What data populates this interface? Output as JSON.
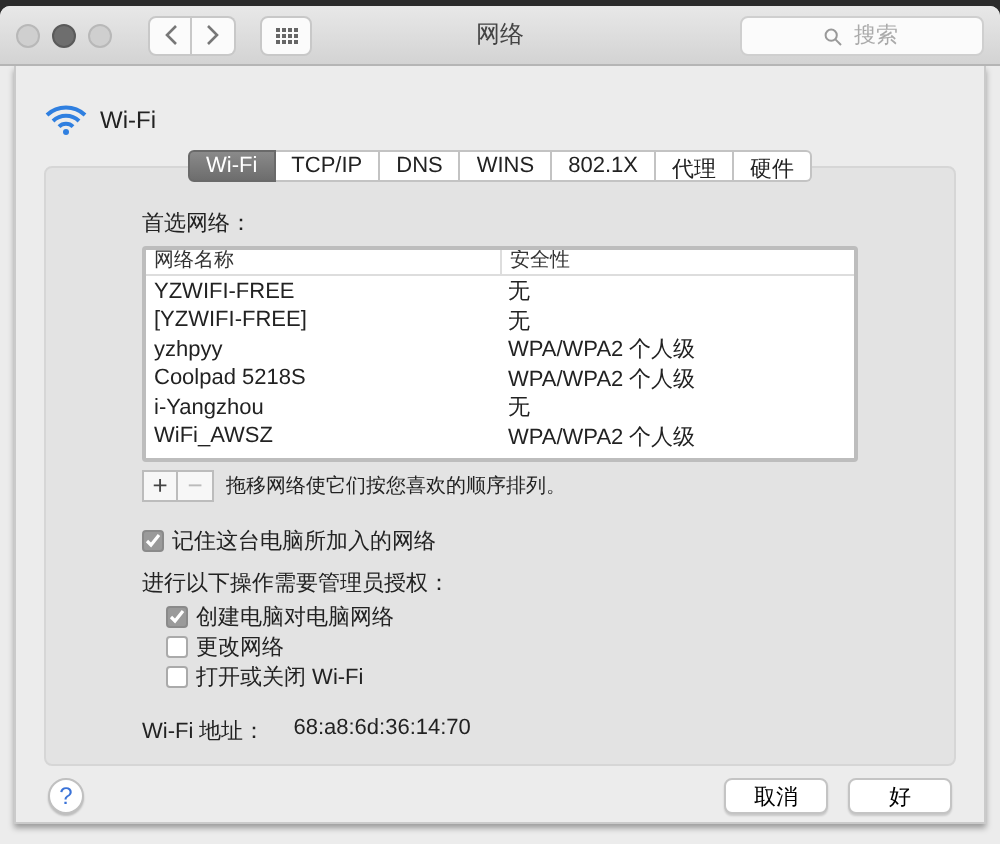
{
  "window": {
    "title": "网络",
    "search": {
      "placeholder": "搜索"
    }
  },
  "header": {
    "title": "Wi-Fi"
  },
  "tabs": [
    {
      "label": "Wi-Fi",
      "selected": true
    },
    {
      "label": "TCP/IP",
      "selected": false
    },
    {
      "label": "DNS",
      "selected": false
    },
    {
      "label": "WINS",
      "selected": false
    },
    {
      "label": "802.1X",
      "selected": false
    },
    {
      "label": "代理",
      "selected": false
    },
    {
      "label": "硬件",
      "selected": false
    }
  ],
  "preferred_networks": {
    "label": "首选网络：",
    "columns": [
      "网络名称",
      "安全性"
    ],
    "rows": [
      {
        "name": "YZWIFI-FREE",
        "security": "无"
      },
      {
        "name": "[YZWIFI-FREE]",
        "security": "无"
      },
      {
        "name": "yzhpyy",
        "security": "WPA/WPA2 个人级"
      },
      {
        "name": "Coolpad 5218S",
        "security": "WPA/WPA2 个人级"
      },
      {
        "name": "i-Yangzhou",
        "security": "无"
      },
      {
        "name": "WiFi_AWSZ",
        "security": "WPA/WPA2 个人级"
      }
    ],
    "add_label": "+",
    "remove_label": "−",
    "hint": "拖移网络使它们按您喜欢的顺序排列。"
  },
  "remember": {
    "label": "记住这台电脑所加入的网络",
    "checked": true
  },
  "admin_label": "进行以下操作需要管理员授权：",
  "admin_options": [
    {
      "label": "创建电脑对电脑网络",
      "checked": true
    },
    {
      "label": "更改网络",
      "checked": false
    },
    {
      "label": "打开或关闭 Wi-Fi",
      "checked": false
    }
  ],
  "address": {
    "label": "Wi-Fi 地址：",
    "value": "68:a8:6d:36:14:70"
  },
  "help_label": "?",
  "buttons": [
    "取消",
    "好"
  ]
}
